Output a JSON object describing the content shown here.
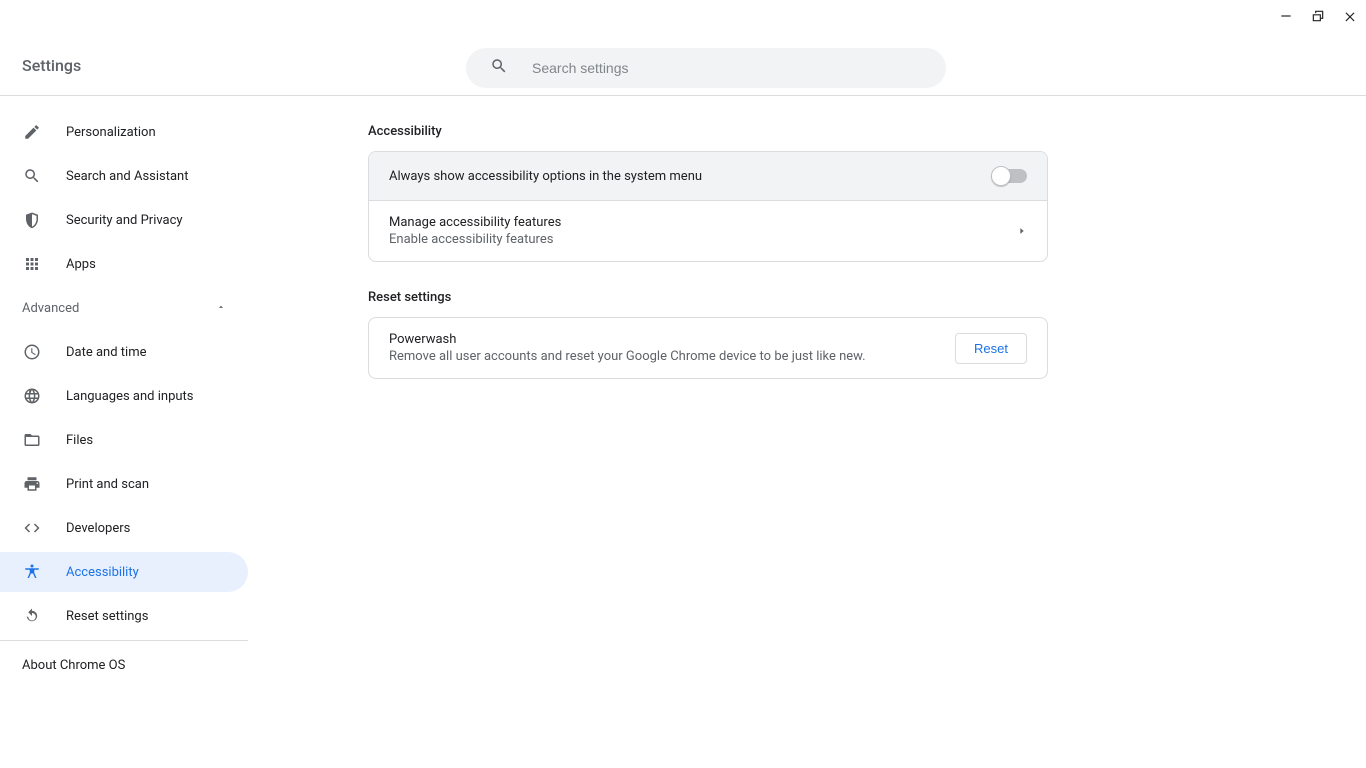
{
  "window": {
    "minimize": "minimize",
    "maximize": "restore",
    "close": "close"
  },
  "header": {
    "title": "Settings",
    "search_placeholder": "Search settings"
  },
  "sidebar": {
    "items_top": [
      {
        "id": "personalization",
        "label": "Personalization",
        "icon": "pencil"
      },
      {
        "id": "search-assistant",
        "label": "Search and Assistant",
        "icon": "search"
      },
      {
        "id": "security-privacy",
        "label": "Security and Privacy",
        "icon": "shield"
      },
      {
        "id": "apps",
        "label": "Apps",
        "icon": "apps-grid"
      }
    ],
    "advanced_label": "Advanced",
    "items_advanced": [
      {
        "id": "date-time",
        "label": "Date and time",
        "icon": "clock"
      },
      {
        "id": "languages-inputs",
        "label": "Languages and inputs",
        "icon": "globe"
      },
      {
        "id": "files",
        "label": "Files",
        "icon": "folder"
      },
      {
        "id": "print-scan",
        "label": "Print and scan",
        "icon": "printer"
      },
      {
        "id": "developers",
        "label": "Developers",
        "icon": "code"
      },
      {
        "id": "accessibility",
        "label": "Accessibility",
        "icon": "accessibility",
        "active": true
      },
      {
        "id": "reset-settings",
        "label": "Reset settings",
        "icon": "reset"
      }
    ],
    "about": "About Chrome OS"
  },
  "main": {
    "accessibility": {
      "title": "Accessibility",
      "toggle_row": "Always show accessibility options in the system menu",
      "toggle_state": false,
      "manage_title": "Manage accessibility features",
      "manage_sub": "Enable accessibility features"
    },
    "reset": {
      "title": "Reset settings",
      "powerwash_title": "Powerwash",
      "powerwash_sub": "Remove all user accounts and reset your Google Chrome device to be just like new.",
      "reset_btn": "Reset"
    }
  },
  "colors": {
    "accent": "#1a73e8",
    "border": "#dadce0",
    "muted": "#5f6368",
    "active_bg": "#e8f0fe",
    "search_bg": "#f1f3f4"
  }
}
